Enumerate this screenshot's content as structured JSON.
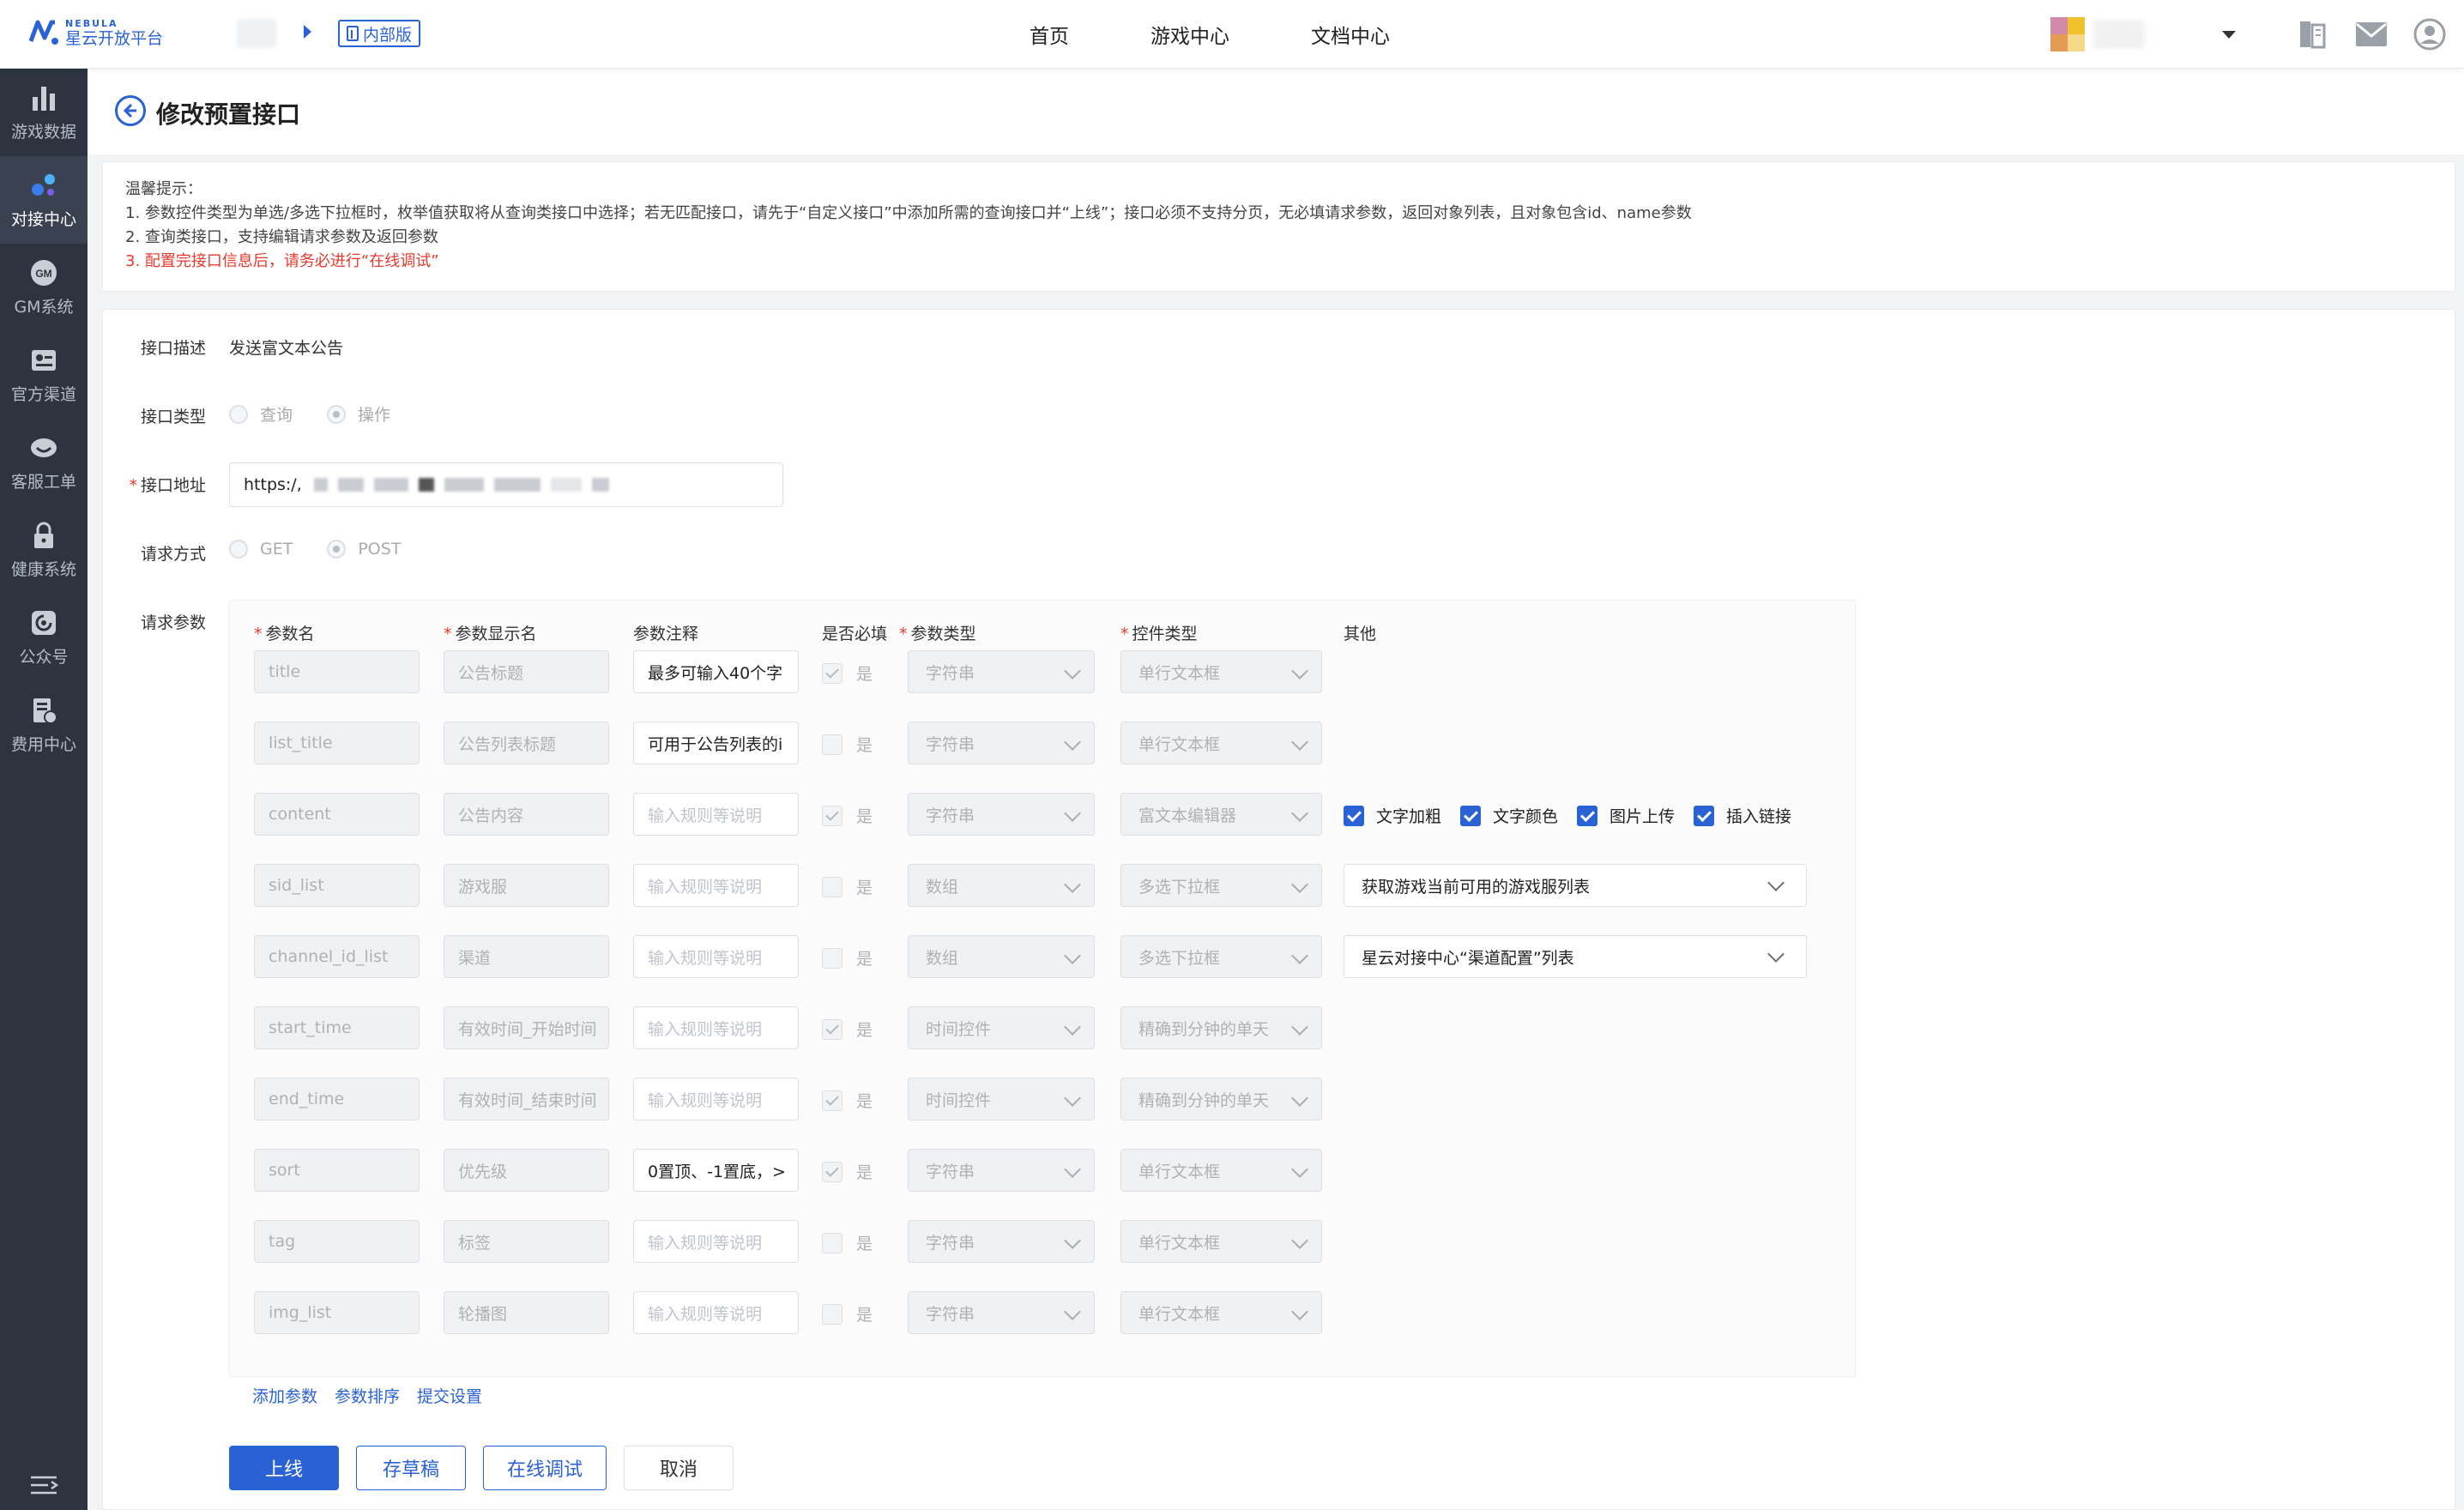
{
  "header": {
    "logo_en": "NEBULA",
    "logo_cn": "星云开放平台",
    "internal_badge": "内部版",
    "nav": [
      "首页",
      "游戏中心",
      "文档中心"
    ]
  },
  "sidebar": {
    "items": [
      {
        "label": "游戏数据",
        "icon": "bar-chart-icon"
      },
      {
        "label": "对接中心",
        "icon": "connect-icon",
        "active": true
      },
      {
        "label": "GM系统",
        "icon": "gm-icon"
      },
      {
        "label": "官方渠道",
        "icon": "id-card-icon"
      },
      {
        "label": "客服工单",
        "icon": "support-icon"
      },
      {
        "label": "健康系统",
        "icon": "lock-icon"
      },
      {
        "label": "公众号",
        "icon": "public-account-icon"
      },
      {
        "label": "费用中心",
        "icon": "billing-icon"
      }
    ]
  },
  "page": {
    "title": "修改预置接口"
  },
  "tips": {
    "heading": "温馨提示：",
    "lines": [
      "1. 参数控件类型为单选/多选下拉框时，枚举值获取将从查询类接口中选择；若无匹配接口，请先于“自定义接口”中添加所需的查询接口并“上线”；接口必须不支持分页，无必填请求参数，返回对象列表，且对象包含id、name参数",
      "2. 查询类接口，支持编辑请求参数及返回参数",
      "3. 配置完接口信息后，请务必进行“在线调试”"
    ]
  },
  "form": {
    "desc_label": "接口描述",
    "desc_value": "发送富文本公告",
    "type_label": "接口类型",
    "type_options": [
      "查询",
      "操作"
    ],
    "url_label": "接口地址",
    "url_value": "https:/,",
    "method_label": "请求方式",
    "method_options": [
      "GET",
      "POST"
    ],
    "params_label": "请求参数"
  },
  "param_table": {
    "headers": [
      "参数名",
      "参数显示名",
      "参数注释",
      "是否必填",
      "参数类型",
      "控件类型",
      "其他"
    ],
    "required_label": "是",
    "rows": [
      {
        "name": "title",
        "display": "公告标题",
        "note": "最多可输入40个字",
        "note_filled": true,
        "required": true,
        "ptype": "字符串",
        "ctype": "单行文本框"
      },
      {
        "name": "list_title",
        "display": "公告列表标题",
        "note": "可用于公告列表的i",
        "note_filled": true,
        "required": false,
        "ptype": "字符串",
        "ctype": "单行文本框"
      },
      {
        "name": "content",
        "display": "公告内容",
        "note": "输入规则等说明",
        "note_filled": false,
        "required": true,
        "ptype": "字符串",
        "ctype": "富文本编辑器"
      },
      {
        "name": "sid_list",
        "display": "游戏服",
        "note": "输入规则等说明",
        "note_filled": false,
        "required": false,
        "ptype": "数组",
        "ctype": "多选下拉框"
      },
      {
        "name": "channel_id_list",
        "display": "渠道",
        "note": "输入规则等说明",
        "note_filled": false,
        "required": false,
        "ptype": "数组",
        "ctype": "多选下拉框"
      },
      {
        "name": "start_time",
        "display": "有效时间_开始时间",
        "note": "输入规则等说明",
        "note_filled": false,
        "required": true,
        "ptype": "时间控件",
        "ctype": "精确到分钟的单天"
      },
      {
        "name": "end_time",
        "display": "有效时间_结束时间",
        "note": "输入规则等说明",
        "note_filled": false,
        "required": true,
        "ptype": "时间控件",
        "ctype": "精确到分钟的单天"
      },
      {
        "name": "sort",
        "display": "优先级",
        "note": "0置顶、-1置底，>",
        "note_filled": true,
        "required": true,
        "ptype": "字符串",
        "ctype": "单行文本框"
      },
      {
        "name": "tag",
        "display": "标签",
        "note": "输入规则等说明",
        "note_filled": false,
        "required": false,
        "ptype": "字符串",
        "ctype": "单行文本框"
      },
      {
        "name": "img_list",
        "display": "轮播图",
        "note": "输入规则等说明",
        "note_filled": false,
        "required": false,
        "ptype": "字符串",
        "ctype": "单行文本框"
      }
    ],
    "content_options": [
      "文字加粗",
      "文字颜色",
      "图片上传",
      "插入链接"
    ],
    "sid_source": "获取游戏当前可用的游戏服列表",
    "channel_source": "星云对接中心“渠道配置”列表"
  },
  "links": [
    "添加参数",
    "参数排序",
    "提交设置"
  ],
  "buttons": {
    "online": "上线",
    "draft": "存草稿",
    "debug": "在线调试",
    "cancel": "取消"
  },
  "colors": {
    "accent": "#2a62d6",
    "sidebar_bg": "#2d3440",
    "warning": "#e8392c"
  }
}
